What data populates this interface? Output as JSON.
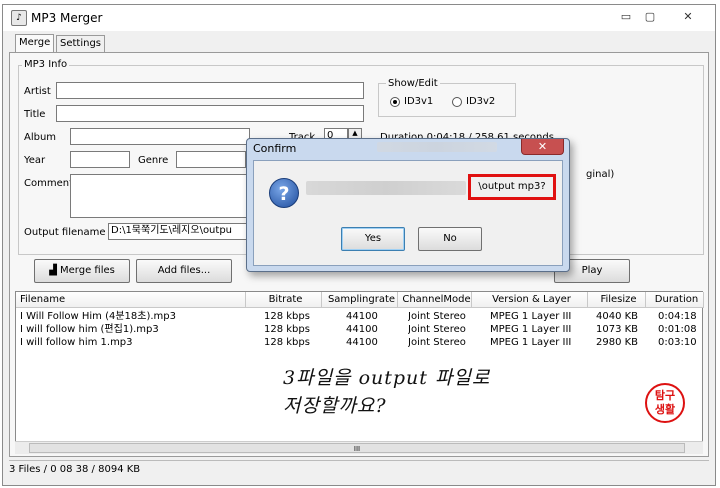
{
  "window": {
    "title": "MP3 Merger",
    "controls": {
      "minimize": "▭",
      "maximize": "▢",
      "close": "✕"
    }
  },
  "tabs": [
    {
      "label": "Merge"
    },
    {
      "label": "Settings"
    }
  ],
  "mp3info": {
    "group_label": "MP3 Info",
    "artist_label": "Artist",
    "title_label": "Title",
    "album_label": "Album",
    "track_label": "Track",
    "track_value": "0",
    "year_label": "Year",
    "genre_label": "Genre",
    "comment_label": "Comment",
    "output_label": "Output filename",
    "output_value": "D:\\1묵쭉기도\\레지오\\outpu"
  },
  "showedit": {
    "label": "Show/Edit",
    "options": [
      {
        "label": "ID3v1",
        "selected": true
      },
      {
        "label": "ID3v2",
        "selected": false
      }
    ]
  },
  "duration_text": "Duration 0:04:18 / 258.61 seconds",
  "buttons": {
    "merge": "Merge files",
    "add": "Add files...",
    "play": "Play"
  },
  "list": {
    "columns": [
      "Filename",
      "Bitrate",
      "Samplingrate",
      "ChannelMode",
      "Version & Layer",
      "Filesize",
      "Duration"
    ],
    "rows": [
      [
        "I Will Follow Him (4분18초).mp3",
        "128 kbps",
        "44100",
        "Joint Stereo",
        "MPEG 1 Layer III",
        "4040 KB",
        "0:04:18"
      ],
      [
        "I will follow him (편집1).mp3",
        "128 kbps",
        "44100",
        "Joint Stereo",
        "MPEG 1 Layer III",
        "1073 KB",
        "0:01:08"
      ],
      [
        "I will follow him 1.mp3",
        "128 kbps",
        "44100",
        "Joint Stereo",
        "MPEG 1 Layer III",
        "2980 KB",
        "0:03:10"
      ]
    ]
  },
  "scroll_glyph": "III",
  "status_text": "3 Files / 0 08 38 / 8094 KB",
  "dialog": {
    "title": "Confirm",
    "close_glyph": "✕",
    "message_tail": "\\output mp3?",
    "yes": "Yes",
    "no": "No",
    "behind_partial": "ginal)"
  },
  "annotation": {
    "line1": "3파일을 output 파일로",
    "line2": "저장할까요?",
    "stamp_top": "탐구",
    "stamp_bottom": "생활"
  },
  "colors": {
    "highlight": "#e01010",
    "dialog_frame": "#c9d9ee"
  }
}
